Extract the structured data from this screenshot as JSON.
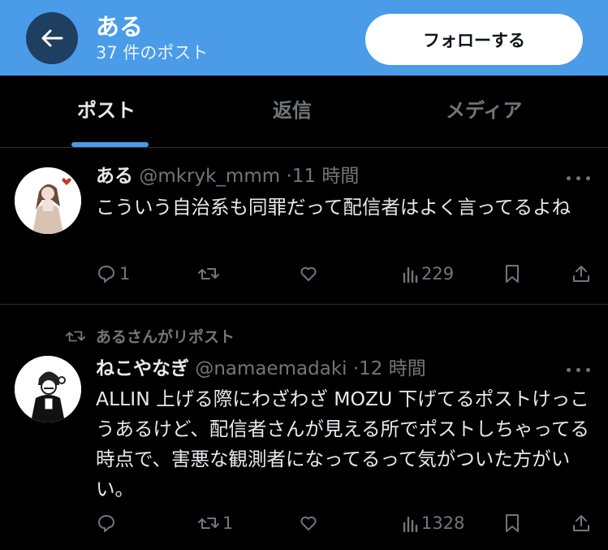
{
  "header": {
    "name": "ある",
    "post_count": "37 件のポスト",
    "follow_label": "フォローする"
  },
  "tabs": [
    {
      "label": "ポスト",
      "active": true
    },
    {
      "label": "返信",
      "active": false
    },
    {
      "label": "メディア",
      "active": false
    }
  ],
  "posts": [
    {
      "name": "ある",
      "handle": "@mkryk_mmm",
      "time": "11 時間",
      "text": "こういう自治系も同罪だって配信者はよく言ってるよね",
      "replies": "1",
      "reposts": "",
      "views": "229"
    },
    {
      "repost_context": "あるさんがリポスト",
      "name": "ねこやなぎ",
      "handle": "@namaemadaki",
      "time": "12 時間",
      "text": "ALLIN 上げる際にわざわざ MOZU 下げてるポストけっこうあるけど、配信者さんが見える所でポストしちゃってる時点で、害悪な観測者になってるって気がついた方がいい。",
      "replies": "",
      "reposts": "1",
      "views": "1328"
    }
  ],
  "colors": {
    "header_bg": "#4a9be8",
    "back_button_bg": "#1f3f60",
    "accent": "#4a9be8",
    "muted_text": "#71767b",
    "background": "#000000"
  },
  "icons": [
    "back-arrow-icon",
    "more-icon",
    "reply-icon",
    "repost-icon",
    "like-icon",
    "views-icon",
    "bookmark-icon",
    "share-icon"
  ]
}
